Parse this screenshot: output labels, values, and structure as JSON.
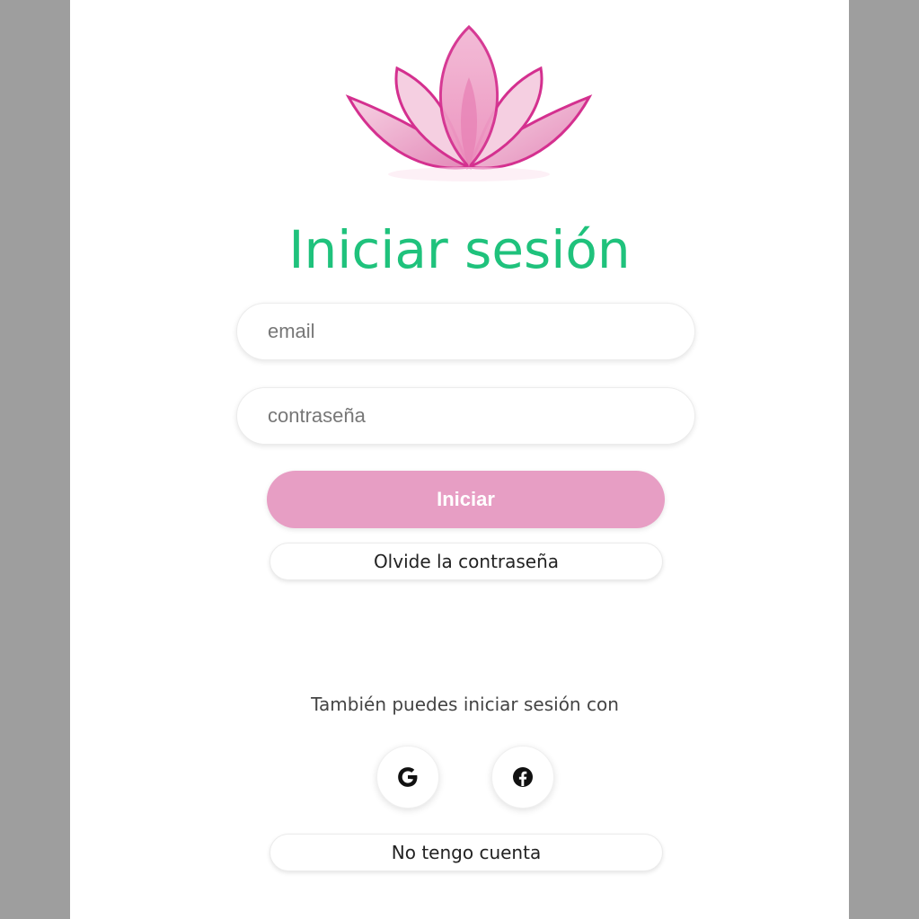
{
  "colors": {
    "title": "#1fc27c",
    "primary_button": "#e79ec4",
    "logo_dark": "#d4308f",
    "logo_light": "#f4c6dc",
    "outer_background": "#9e9e9e"
  },
  "header": {
    "logo_icon": "lotus-icon",
    "title": "Iniciar sesión"
  },
  "form": {
    "email_placeholder": "email",
    "password_placeholder": "contraseña",
    "submit_label": "Iniciar",
    "forgot_label": "Olvide la contraseña"
  },
  "social": {
    "prompt": "También puedes iniciar sesión con",
    "providers": [
      {
        "name": "google",
        "icon": "google-icon"
      },
      {
        "name": "facebook",
        "icon": "facebook-icon"
      }
    ]
  },
  "footer": {
    "no_account_label": "No tengo cuenta"
  }
}
